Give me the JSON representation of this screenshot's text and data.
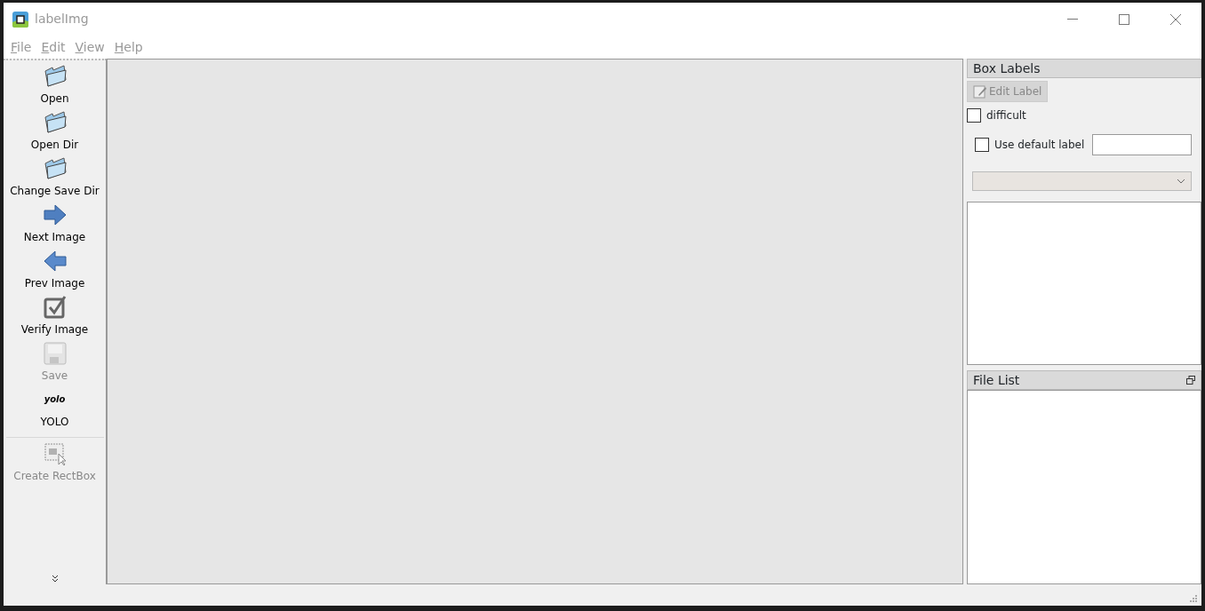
{
  "window": {
    "title": "labelImg"
  },
  "menu": [
    {
      "label": "File"
    },
    {
      "label": "Edit"
    },
    {
      "label": "View"
    },
    {
      "label": "Help"
    }
  ],
  "toolbar": [
    {
      "label": "Open",
      "kind": "folder",
      "disabled": false,
      "separator_before": false
    },
    {
      "label": "Open Dir",
      "kind": "folder",
      "disabled": false,
      "separator_before": false
    },
    {
      "label": "Change Save Dir",
      "kind": "folder",
      "disabled": false,
      "separator_before": false
    },
    {
      "label": "Next Image",
      "kind": "arrow-right",
      "disabled": false,
      "separator_before": false
    },
    {
      "label": "Prev Image",
      "kind": "arrow-left",
      "disabled": false,
      "separator_before": false
    },
    {
      "label": "Verify Image",
      "kind": "check",
      "disabled": false,
      "separator_before": false
    },
    {
      "label": "Save",
      "kind": "floppy",
      "disabled": true,
      "separator_before": false
    },
    {
      "label": "YOLO",
      "kind": "text",
      "icon_text": "yolo",
      "disabled": false,
      "separator_before": false
    },
    {
      "label": "Create RectBox",
      "kind": "rectbox",
      "disabled": true,
      "separator_before": true
    }
  ],
  "box_labels": {
    "title": "Box Labels",
    "edit_button": {
      "label": "Edit Label",
      "disabled": true
    },
    "difficult": {
      "label": "difficult",
      "checked": false
    },
    "use_default": {
      "label": "Use default label",
      "checked": false
    },
    "label_combo": {
      "disabled": true
    }
  },
  "file_list": {
    "title": "File List"
  }
}
